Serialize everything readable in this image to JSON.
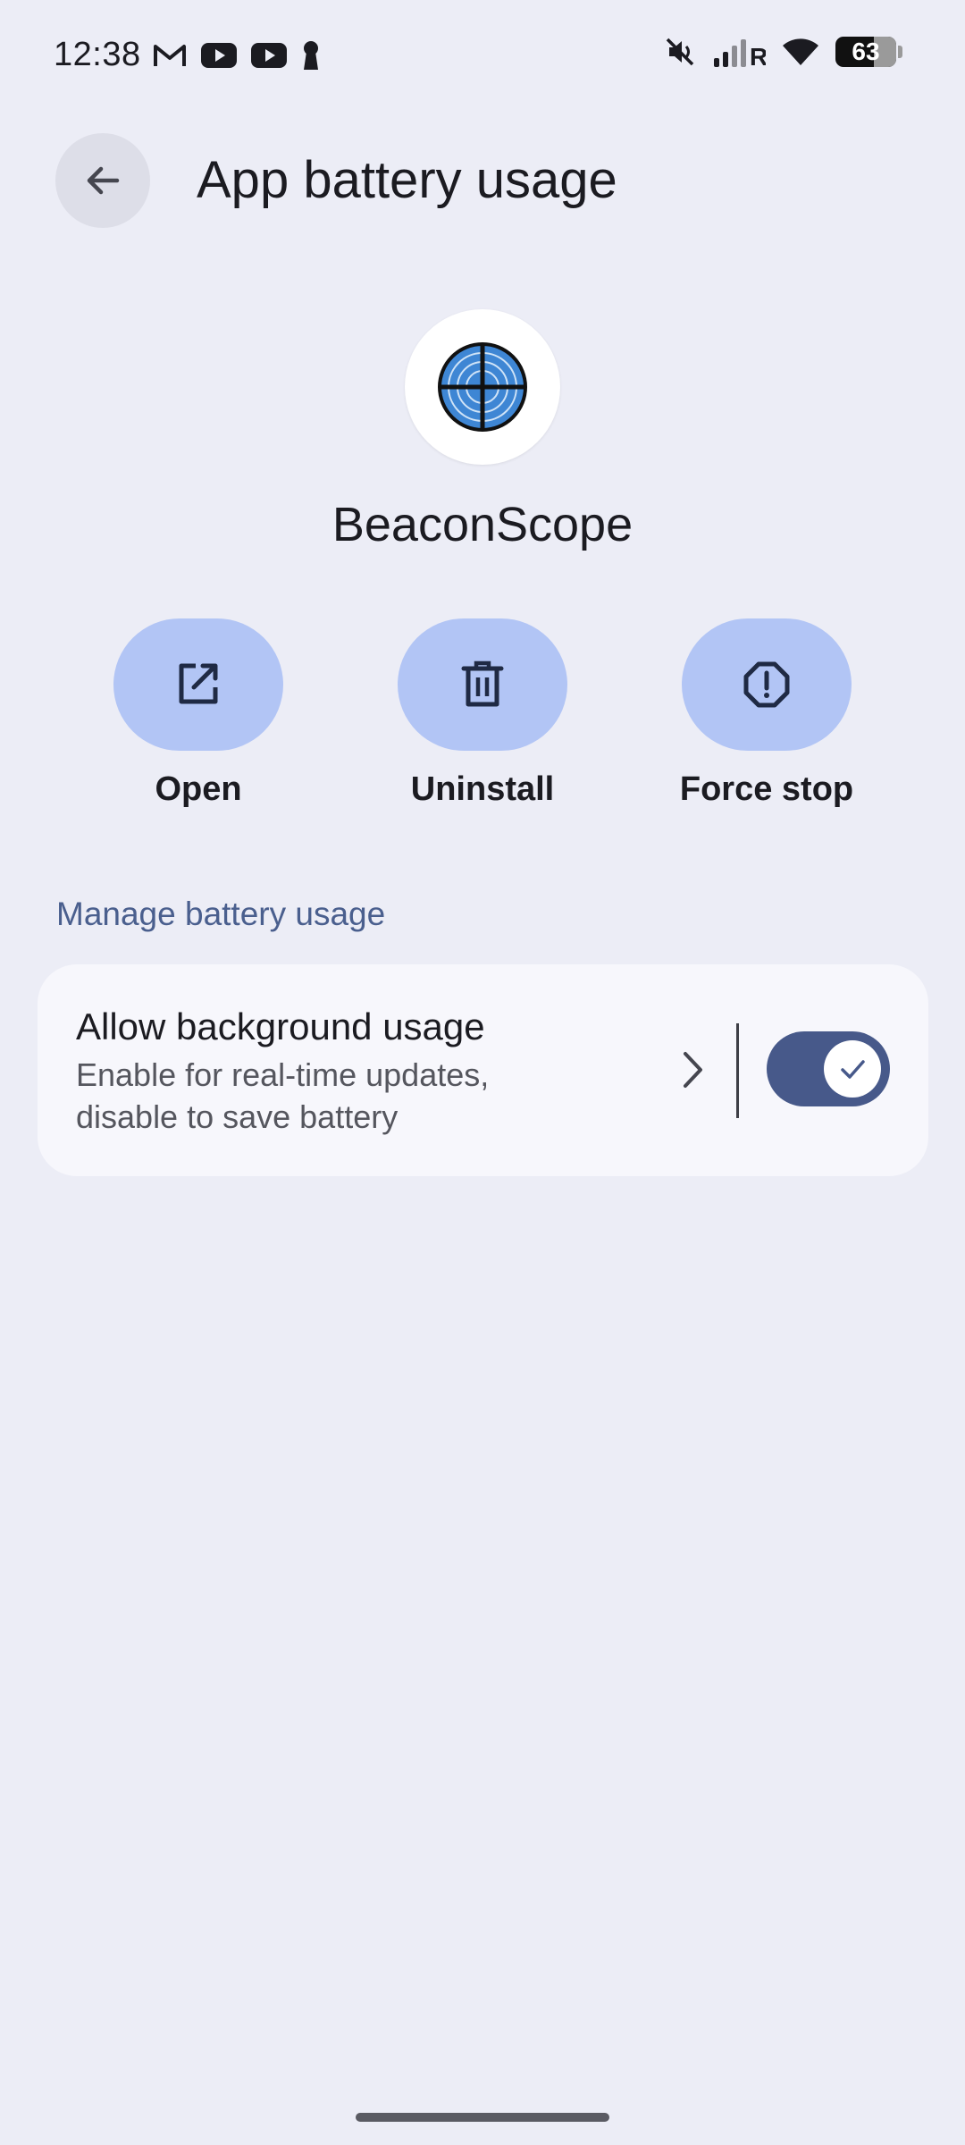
{
  "status_bar": {
    "time": "12:38",
    "battery_percent": "63",
    "battery_level": 0.63,
    "left_icons": [
      "gmail-icon",
      "youtube-icon",
      "youtube-icon",
      "keyhole-icon"
    ],
    "right_icons": [
      "mute-icon",
      "signal-icon",
      "wifi-icon",
      "battery-icon"
    ],
    "roaming_indicator": "R"
  },
  "header": {
    "title": "App battery usage",
    "back_icon": "arrow-back-icon"
  },
  "app": {
    "name": "BeaconScope",
    "icon": "crosshair-radar-icon"
  },
  "actions": [
    {
      "label": "Open",
      "icon": "open-external-icon"
    },
    {
      "label": "Uninstall",
      "icon": "trash-icon"
    },
    {
      "label": "Force stop",
      "icon": "octagon-alert-icon"
    }
  ],
  "section": {
    "title": "Manage battery usage"
  },
  "background_usage": {
    "title": "Allow background usage",
    "subtitle": "Enable for real-time updates, disable to save battery",
    "enabled": true
  },
  "colors": {
    "background": "#ECEDF6",
    "card": "#F7F7FC",
    "action_pill": "#B2C5F5",
    "accent_text": "#4A5F8E",
    "switch_on": "#47598A",
    "app_icon_blue": "#3E86D4"
  }
}
